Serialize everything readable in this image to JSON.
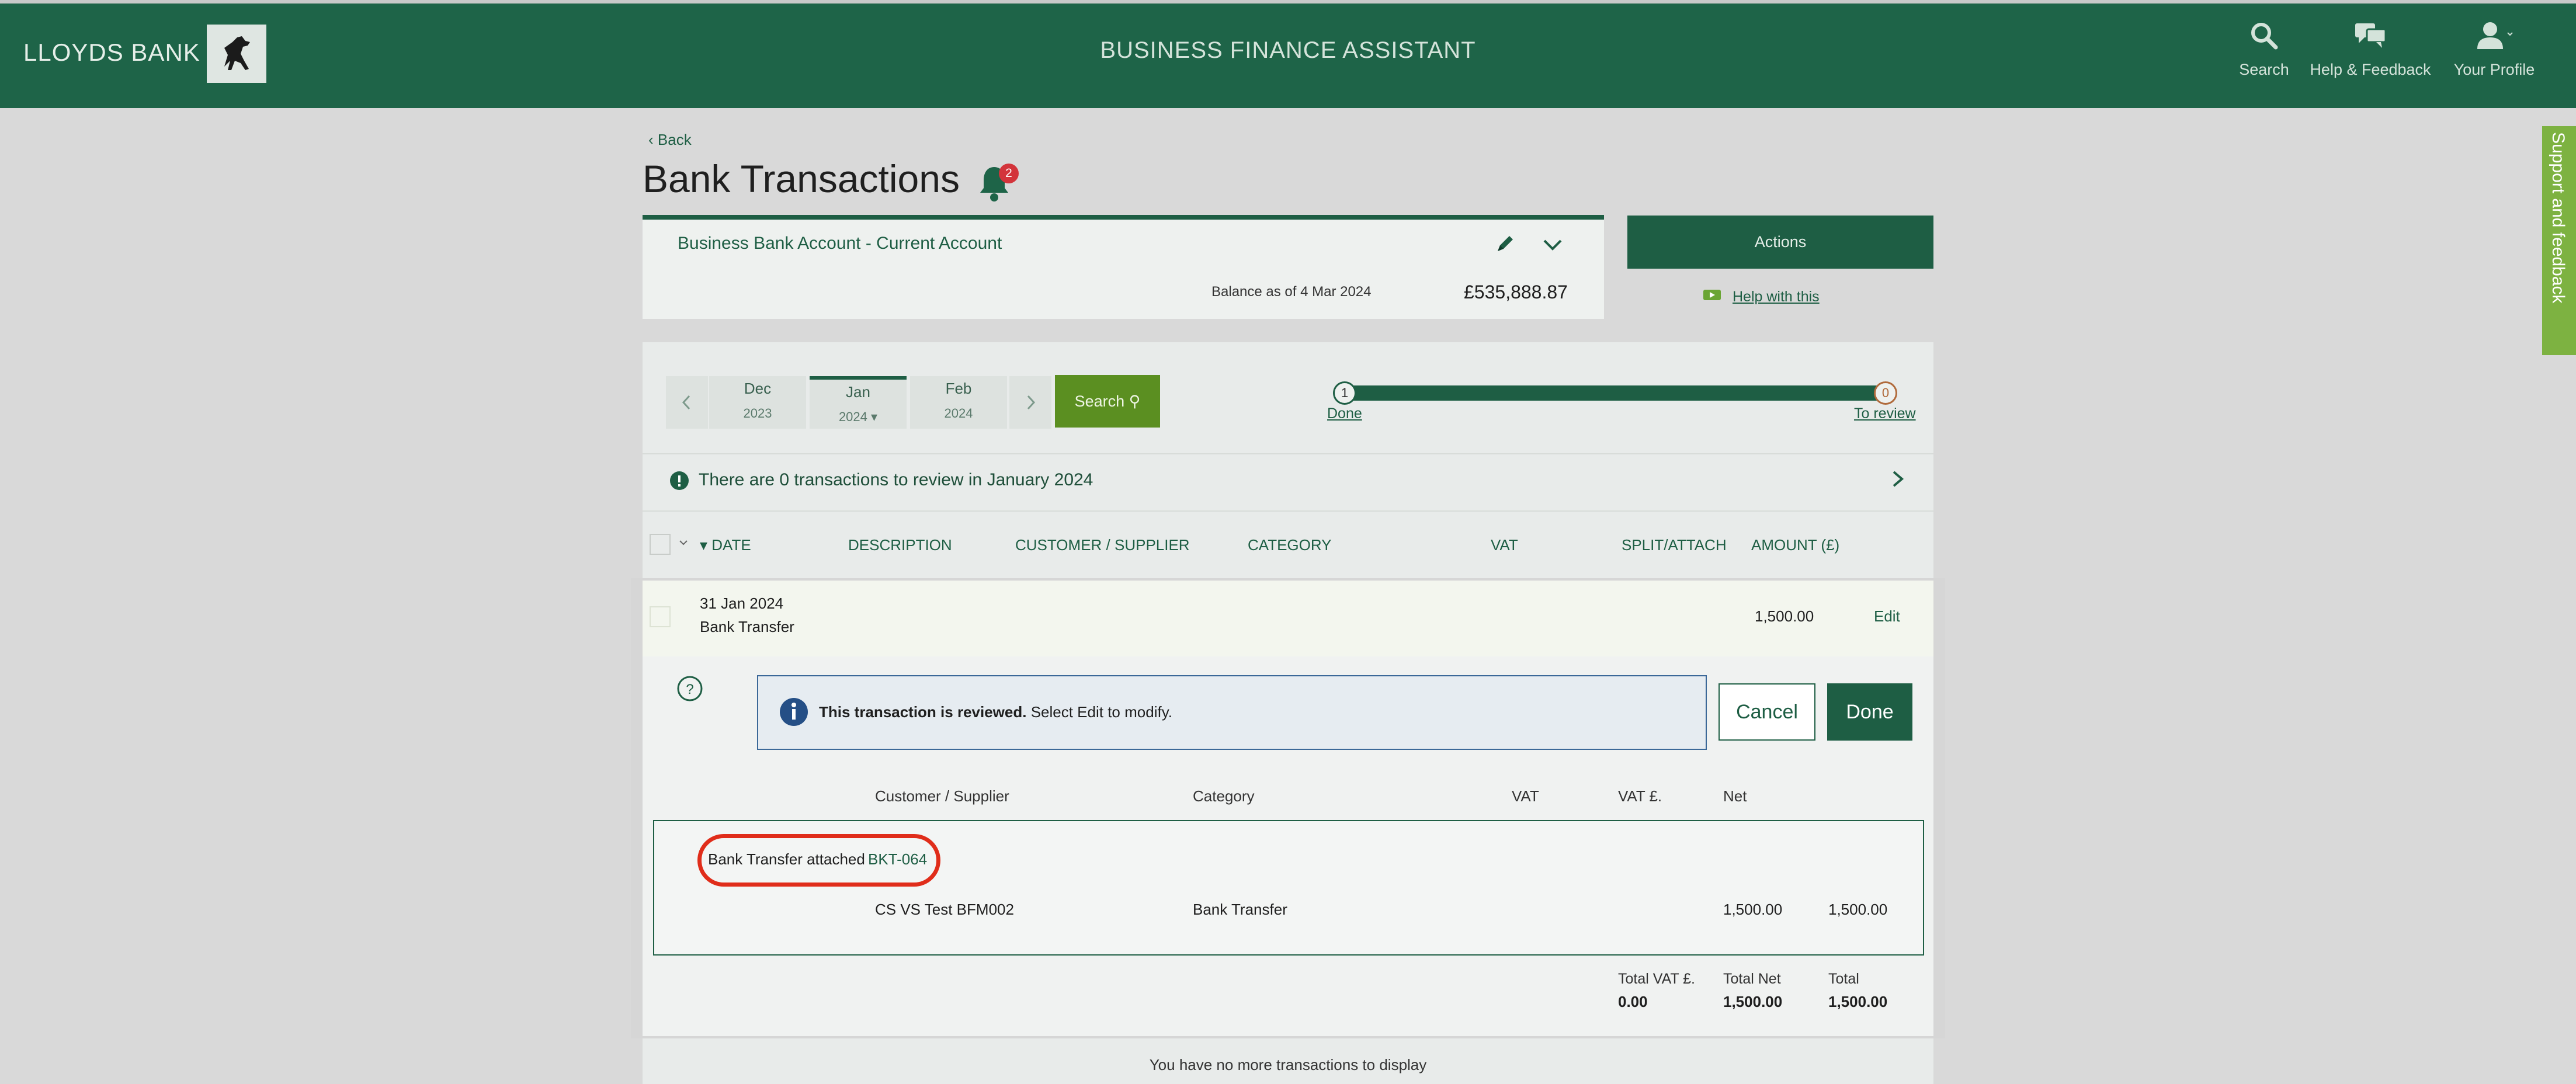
{
  "header": {
    "brand": "LLOYDS BANK",
    "app_title": "BUSINESS FINANCE ASSISTANT",
    "nav": {
      "search": "Search",
      "help": "Help & Feedback",
      "profile": "Your Profile"
    },
    "icons": {
      "logo": "horse-logo-icon",
      "search": "search-icon",
      "help": "chat-bubbles-icon",
      "profile": "user-icon"
    }
  },
  "page": {
    "back": "Back",
    "title": "Bank Transactions",
    "notification_count": "2"
  },
  "account": {
    "name": "Business Bank Account - Current Account",
    "balance_label": "Balance as of 4 Mar 2024",
    "balance": "£535,888.87",
    "actions": "Actions",
    "help_link": "Help with this"
  },
  "side_tab": "Support and feedback",
  "months": [
    {
      "month": "Dec",
      "year": "2023"
    },
    {
      "month": "Jan",
      "year": "2024 ▾"
    },
    {
      "month": "Feb",
      "year": "2024"
    }
  ],
  "search_button": "Search",
  "progress": {
    "done_count": "1",
    "review_count": "0",
    "done_label": "Done",
    "review_label": "To review"
  },
  "review_notice": "There are 0 transactions to review in January 2024",
  "columns": {
    "date": "DATE",
    "description": "DESCRIPTION",
    "customer": "CUSTOMER / SUPPLIER",
    "category": "CATEGORY",
    "vat": "VAT",
    "split": "SPLIT/ATTACH",
    "amount": "AMOUNT (£)"
  },
  "transaction": {
    "date": "31 Jan 2024",
    "description": "Bank Transfer",
    "amount": "1,500.00",
    "edit": "Edit",
    "info_bold": "This transaction is reviewed.",
    "info_rest": " Select Edit to modify.",
    "cancel": "Cancel",
    "done": "Done",
    "detail_columns": {
      "customer": "Customer / Supplier",
      "category": "Category",
      "vat": "VAT",
      "vat_amount": "VAT £.",
      "net": "Net"
    },
    "attached_label": "Bank Transfer attached",
    "attached_code": "BKT-064",
    "split": {
      "customer": "CS VS Test BFM002",
      "category": "Bank Transfer",
      "net": "1,500.00",
      "total": "1,500.00"
    },
    "totals": {
      "vat_label": "Total VAT £.",
      "vat": "0.00",
      "net_label": "Total Net",
      "net": "1,500.00",
      "total_label": "Total",
      "total": "1,500.00"
    }
  },
  "footer_note": "You have no more transactions to display",
  "colors": {
    "brand_green": "#1e6448",
    "accent_green": "#5b8f21",
    "highlight_red": "#e02d1a",
    "side_tab_green": "#7db241"
  }
}
